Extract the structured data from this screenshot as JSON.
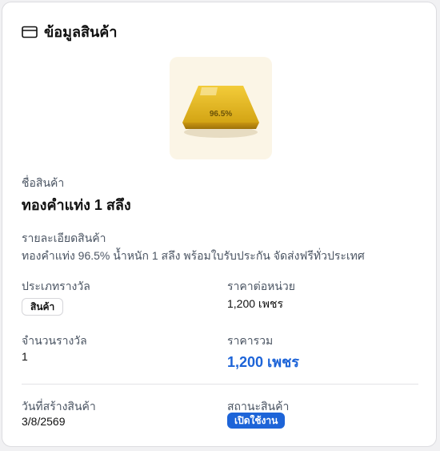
{
  "header": {
    "title": "ข้อมูลสินค้า",
    "icon": "card-icon"
  },
  "product_image": {
    "icon": "gold-bar-icon",
    "overlay_text": "96.5%",
    "bg_color": "#fbf5e6"
  },
  "product": {
    "name_label": "ชื่อสินค้า",
    "name": "ทองคำแท่ง 1 สลึง",
    "description_label": "รายละเอียดสินค้า",
    "description": "ทองคำแท่ง 96.5% น้ำหนัก 1 สลึง พร้อมใบรับประกัน จัดส่งฟรีทั่วประเทศ"
  },
  "details": {
    "type_label": "ประเภทรางวัล",
    "type_value": "สินค้า",
    "unit_price_label": "ราคาต่อหน่วย",
    "unit_price_value": "1,200 เพชร",
    "quantity_label": "จำนวนรางวัล",
    "quantity_value": "1",
    "total_label": "ราคารวม",
    "total_value": "1,200 เพชร",
    "total_color": "#1d64d8"
  },
  "meta": {
    "created_label": "วันที่สร้างสินค้า",
    "created_value": "3/8/2569",
    "status_label": "สถานะสินค้า",
    "status_value": "เปิดใช้งาน",
    "status_color": "#1d64d8"
  }
}
